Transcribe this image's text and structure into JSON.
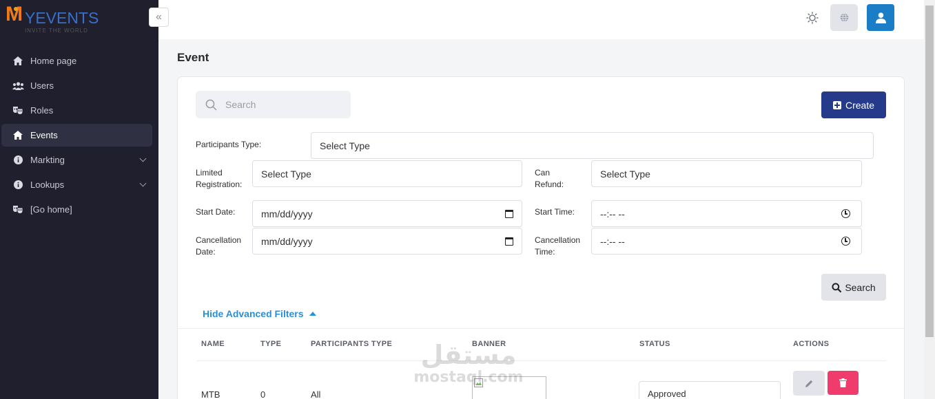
{
  "brand": {
    "logo_text": "MYEVENTS",
    "logo_subtitle": "INVITE THE WORLD"
  },
  "sidebar": {
    "items": [
      {
        "label": "Home page",
        "icon": "home-icon",
        "active": false
      },
      {
        "label": "Users",
        "icon": "users-icon",
        "active": false
      },
      {
        "label": "Roles",
        "icon": "masks-icon",
        "active": false
      },
      {
        "label": "Events",
        "icon": "home-icon",
        "active": true
      },
      {
        "label": "Markting",
        "icon": "info-icon",
        "active": false,
        "expandable": true
      },
      {
        "label": "Lookups",
        "icon": "info-icon",
        "active": false,
        "expandable": true
      },
      {
        "label": "[Go home]",
        "icon": "masks-icon",
        "active": false
      }
    ]
  },
  "header": {
    "collapse_icon": "double-chevron-left-icon",
    "theme_icon": "sun-icon",
    "language_icon": "globe-icon",
    "user_icon": "user-icon"
  },
  "page": {
    "title": "Event"
  },
  "toolbar": {
    "search_placeholder": "Search",
    "create_label": "Create"
  },
  "filters": {
    "participants_type": {
      "label": "Participants Type:",
      "value": "Select Type"
    },
    "limited_registration": {
      "label_line1": "Limited",
      "label_line2": "Registration:",
      "value": "Select Type"
    },
    "can_refund": {
      "label_line1": "Can",
      "label_line2": "Refund:",
      "value": "Select Type"
    },
    "start_date": {
      "label": "Start Date:",
      "value": "mm/dd/yyyy"
    },
    "start_time": {
      "label": "Start Time:",
      "value": "--:-- --"
    },
    "cancellation_date": {
      "label_line1": "Cancellation",
      "label_line2": "Date:",
      "value": "mm/dd/yyyy"
    },
    "cancellation_time": {
      "label_line1": "Cancellation",
      "label_line2": "Time:",
      "value": "--:-- --"
    },
    "search_button": "Search",
    "toggle_label": "Hide Advanced Filters"
  },
  "table": {
    "columns": [
      "NAME",
      "TYPE",
      "PARTICIPANTS TYPE",
      "BANNER",
      "STATUS",
      "ACTIONS"
    ],
    "rows": [
      {
        "name": "MTB",
        "type": "0",
        "participants_type": "All",
        "status": "Approved"
      }
    ]
  },
  "watermark": {
    "arabic": "مستقل",
    "latin": "mostaql.com"
  },
  "colors": {
    "sidebar_bg": "#1f1f2e",
    "primary": "#263a8c",
    "accent": "#2b8fd6",
    "danger": "#f03c6c",
    "user_button": "#1a7dc6"
  }
}
